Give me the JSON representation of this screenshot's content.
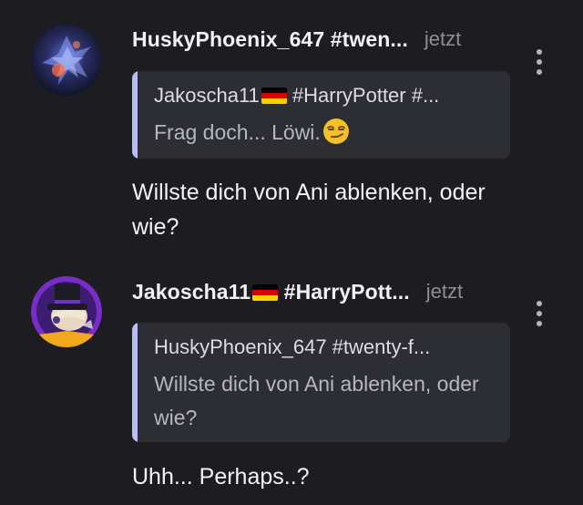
{
  "colors": {
    "background": "#1c1c21",
    "quote_background": "#2d2d34",
    "quote_accent": "#b8bdf5",
    "timestamp": "#8e8e96"
  },
  "messages": [
    {
      "author": "HuskyPhoenix_647 #twen...",
      "time": "jetzt",
      "avatar_icon": "phoenix-avatar",
      "quote": {
        "author": "Jakoscha11",
        "author_tag": "#HarryPotter #...",
        "author_flag_icon": "germany-flag-emoji",
        "text": "Frag doch... Löwi.",
        "text_emoji_icon": "smirking-face-emoji"
      },
      "text": "Willste dich von Ani ablenken, oder wie?"
    },
    {
      "author": "Jakoscha11",
      "author_flag_icon": "germany-flag-emoji",
      "author_tag": "#HarryPott...",
      "time": "jetzt",
      "avatar_icon": "wizard-hat-avatar",
      "quote": {
        "author": "HuskyPhoenix_647 #twenty-f...",
        "text": "Willste dich von Ani ablenken, oder wie?"
      },
      "text": "Uhh... Perhaps..?"
    }
  ]
}
